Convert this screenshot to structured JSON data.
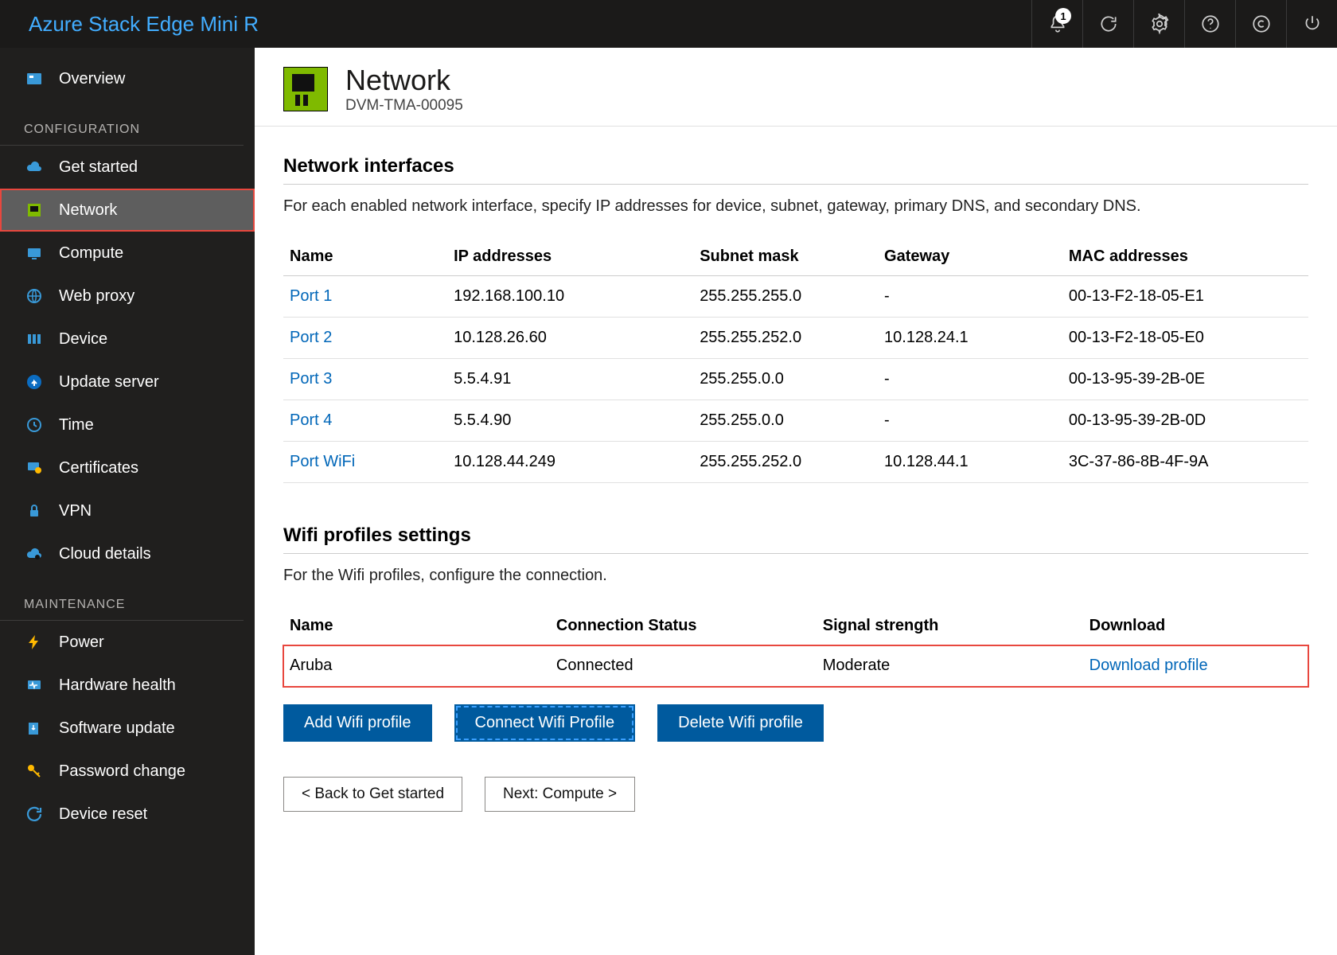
{
  "topbar": {
    "title": "Azure Stack Edge Mini R",
    "notification_badge": "1"
  },
  "sidebar": {
    "overview": "Overview",
    "section_config": "CONFIGURATION",
    "config_items": [
      "Get started",
      "Network",
      "Compute",
      "Web proxy",
      "Device",
      "Update server",
      "Time",
      "Certificates",
      "VPN",
      "Cloud details"
    ],
    "section_maint": "MAINTENANCE",
    "maint_items": [
      "Power",
      "Hardware health",
      "Software update",
      "Password change",
      "Device reset"
    ]
  },
  "page": {
    "title": "Network",
    "subtitle": "DVM-TMA-00095"
  },
  "network_interfaces": {
    "heading": "Network interfaces",
    "desc": "For each enabled network interface, specify IP addresses for device, subnet, gateway, primary DNS, and secondary DNS.",
    "columns": [
      "Name",
      "IP addresses",
      "Subnet mask",
      "Gateway",
      "MAC addresses"
    ],
    "rows": [
      {
        "name": "Port 1",
        "ip": "192.168.100.10",
        "mask": "255.255.255.0",
        "gw": "-",
        "mac": "00-13-F2-18-05-E1"
      },
      {
        "name": "Port 2",
        "ip": "10.128.26.60",
        "mask": "255.255.252.0",
        "gw": "10.128.24.1",
        "mac": "00-13-F2-18-05-E0"
      },
      {
        "name": "Port 3",
        "ip": "5.5.4.91",
        "mask": "255.255.0.0",
        "gw": "-",
        "mac": "00-13-95-39-2B-0E"
      },
      {
        "name": "Port 4",
        "ip": "5.5.4.90",
        "mask": "255.255.0.0",
        "gw": "-",
        "mac": "00-13-95-39-2B-0D"
      },
      {
        "name": "Port WiFi",
        "ip": "10.128.44.249",
        "mask": "255.255.252.0",
        "gw": "10.128.44.1",
        "mac": "3C-37-86-8B-4F-9A"
      }
    ]
  },
  "wifi_profiles": {
    "heading": "Wifi profiles settings",
    "desc": "For the Wifi profiles, configure the connection.",
    "columns": [
      "Name",
      "Connection Status",
      "Signal strength",
      "Download"
    ],
    "rows": [
      {
        "name": "Aruba",
        "status": "Connected",
        "signal": "Moderate",
        "download": "Download profile"
      }
    ],
    "buttons": {
      "add": "Add Wifi profile",
      "connect": "Connect Wifi Profile",
      "delete": "Delete Wifi profile"
    }
  },
  "nav": {
    "back": "< Back to Get started",
    "next": "Next: Compute >"
  }
}
